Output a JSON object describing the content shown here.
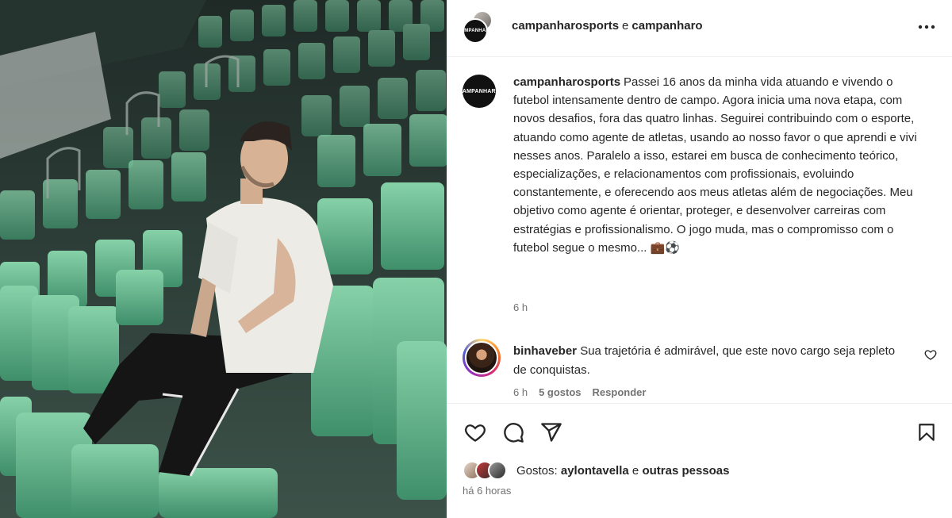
{
  "header": {
    "author": "campanharosports",
    "conjunction": "e",
    "coauthor": "campanharo",
    "more_icon": "more-horizontal-icon"
  },
  "caption": {
    "username": "campanharosports",
    "text": "Passei 16 anos da minha vida atuando e vivendo o futebol intensamente dentro de campo. Agora inicia uma nova etapa, com novos desafios, fora das quatro linhas. Seguirei contribuindo com o esporte, atuando como agente de atletas, usando ao nosso favor o que aprendi e vivi nesses anos. Paralelo a isso, estarei em busca de conhecimento teórico, especializações, e relacionamentos com profissionais, evoluindo constantemente, e oferecendo aos meus atletas além de negociações. Meu objetivo como agente é orientar, proteger, e desenvolver carreiras com estratégias e profissionalismo. O jogo muda, mas o compromisso com o futebol segue o mesmo... 💼⚽",
    "time": "6 h"
  },
  "comment": {
    "username": "binhaveber",
    "text": "Sua trajetória é admirável, que este novo cargo seja repleto de conquistas.",
    "time": "6 h",
    "likes": "5 gostos",
    "reply": "Responder"
  },
  "actions": {
    "like_icon": "heart-icon",
    "comment_icon": "comment-icon",
    "share_icon": "send-icon",
    "save_icon": "bookmark-icon"
  },
  "likes": {
    "prefix": "Gostos:",
    "user": "aylontavella",
    "connector": "e",
    "others": "outras pessoas"
  },
  "posted": "há 6 horas",
  "colors": {
    "seat_green": "#5fb58a",
    "seat_dark": "#2f6e55",
    "text": "#262626",
    "muted": "#737373"
  }
}
